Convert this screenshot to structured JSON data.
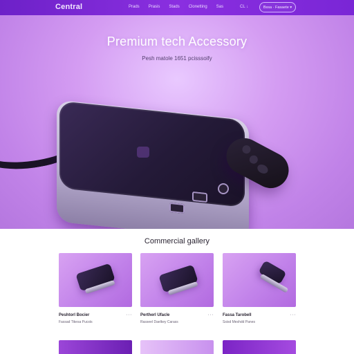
{
  "nav": {
    "logo": "Central",
    "links": [
      "Prads",
      "Prasis",
      "Stads",
      "Clonetting",
      "Sas"
    ],
    "util": "CL ↓",
    "button": "Bssa · Fasaete ▾"
  },
  "hero": {
    "title": "Premium tech Accessory",
    "subtitle": "Pesh matole 1651 pcisssoify"
  },
  "gallery": {
    "title": "Commercial gallery",
    "cards": [
      {
        "name": "Peshtorl Bocier",
        "more": "···",
        "meta": "Fassad Tikesa Pucsts"
      },
      {
        "name": "Pertherl Ufacle",
        "more": "···",
        "meta": "Rasseel Daelkey Carass"
      },
      {
        "name": "Fassa Tarobell",
        "more": "···",
        "meta": "Ssisd Meshdd Panes"
      }
    ]
  },
  "colors": {
    "nav": "#7a26d6",
    "hero": "#c183e8",
    "text_dark": "#2a2432"
  },
  "icons": {
    "logo": "brand-wordmark",
    "device": "media-box-illustration",
    "remote": "remote-control-illustration",
    "more": "ellipsis-icon"
  }
}
